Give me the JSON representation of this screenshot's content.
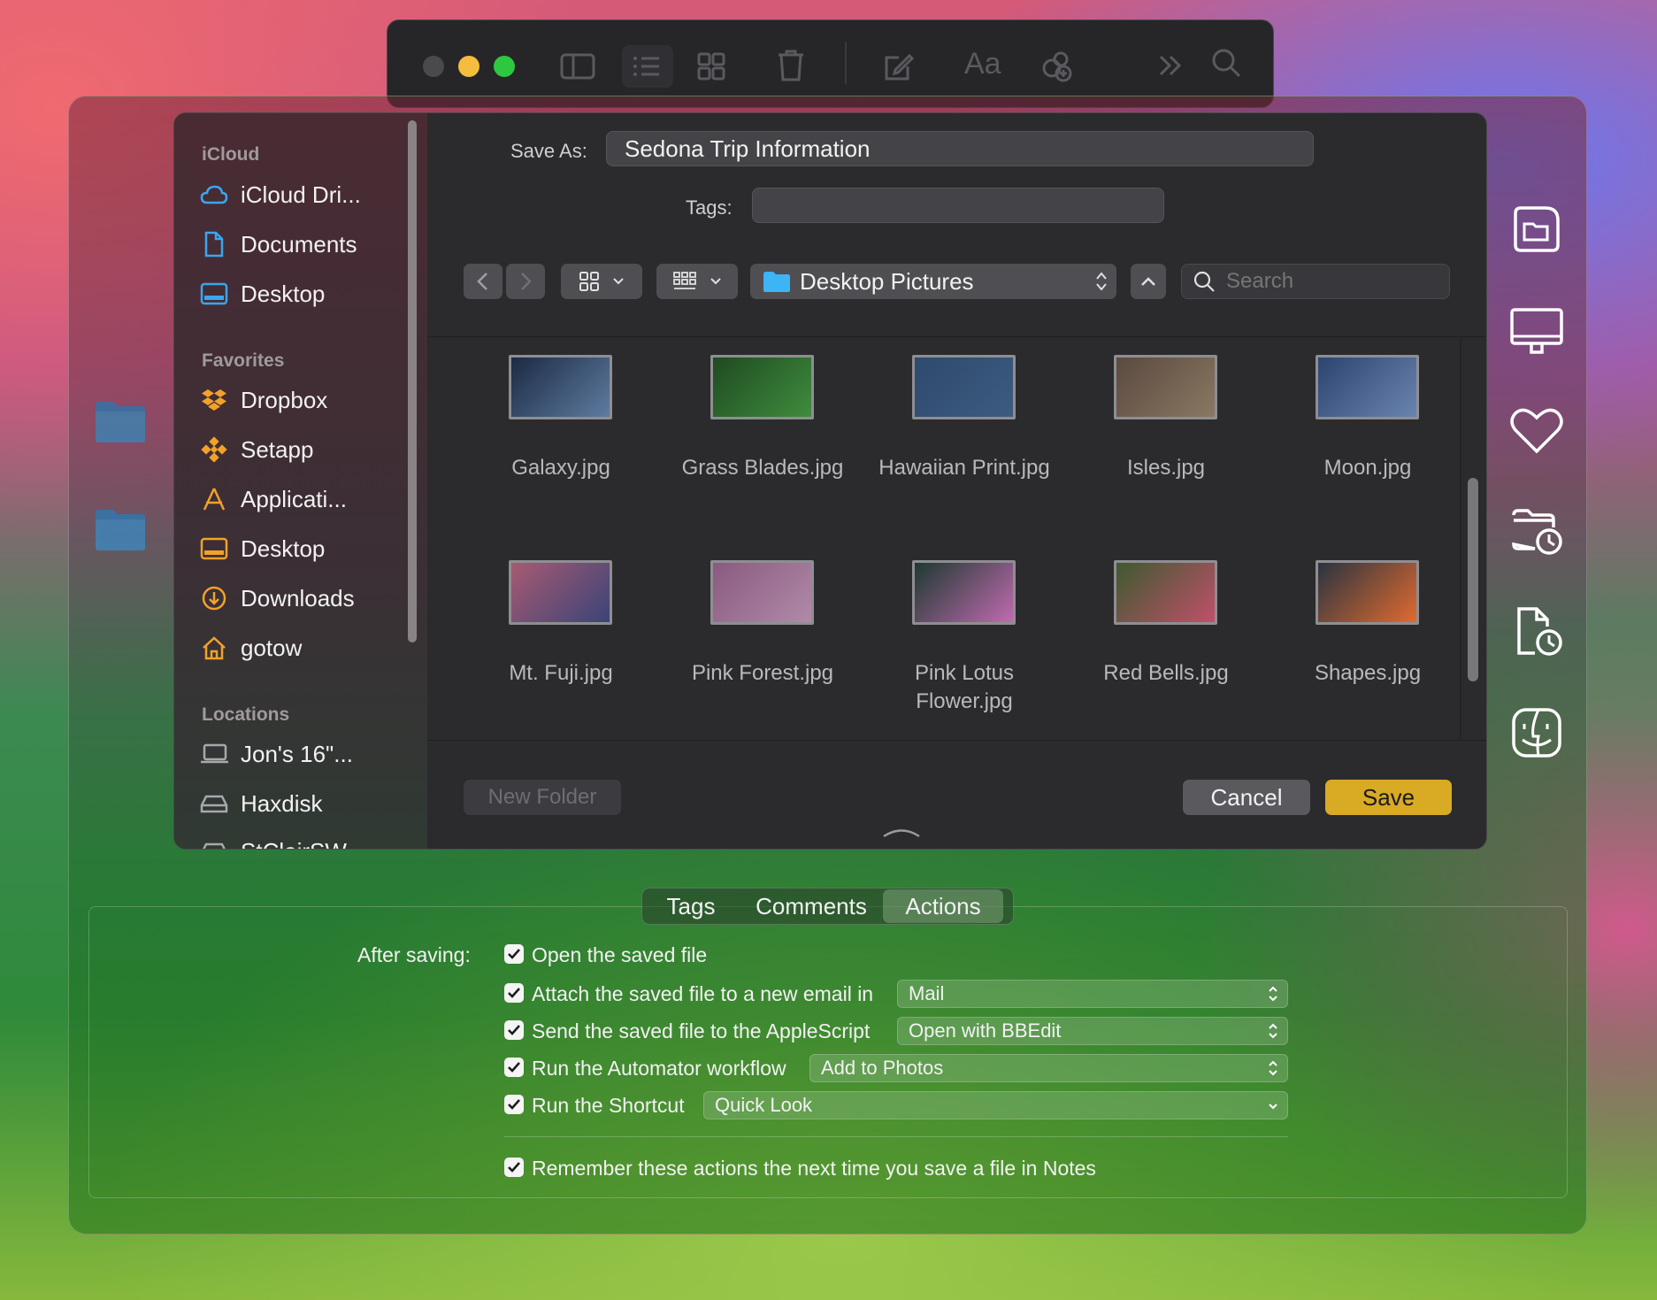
{
  "notes_toolbar": {
    "buttons": [
      "sidebar-icon",
      "list-icon",
      "gallery-icon",
      "trash-icon",
      "compose-icon",
      "format-icon",
      "collaborate-icon",
      "more-icon",
      "search-icon"
    ],
    "format_label": "Aa"
  },
  "dialog": {
    "save_as_label": "Save As:",
    "save_as_value": "Sedona Trip Information",
    "tags_label": "Tags:",
    "tags_value": "",
    "location": "Desktop Pictures",
    "search_placeholder": "Search",
    "new_folder": "New Folder",
    "cancel": "Cancel",
    "save": "Save",
    "accent_color": "#e0b02a"
  },
  "sidebar": {
    "sections": [
      {
        "title": "iCloud",
        "items": [
          {
            "label": "iCloud Dri...",
            "icon": "cloud-icon"
          },
          {
            "label": "Documents",
            "icon": "document-icon"
          },
          {
            "label": "Desktop",
            "icon": "desktop-icon"
          }
        ]
      },
      {
        "title": "Favorites",
        "items": [
          {
            "label": "Dropbox",
            "icon": "dropbox-icon"
          },
          {
            "label": "Setapp",
            "icon": "setapp-icon"
          },
          {
            "label": "Applicati...",
            "icon": "applications-icon"
          },
          {
            "label": "Desktop",
            "icon": "desktop-icon"
          },
          {
            "label": "Downloads",
            "icon": "downloads-icon"
          },
          {
            "label": "gotow",
            "icon": "home-icon"
          }
        ]
      },
      {
        "title": "Locations",
        "items": [
          {
            "label": "Jon's 16\"...",
            "icon": "laptop-icon"
          },
          {
            "label": "Haxdisk",
            "icon": "disk-icon"
          },
          {
            "label": "StClairSW...",
            "icon": "disk-icon"
          }
        ]
      }
    ]
  },
  "files": [
    {
      "name": "Galaxy.jpg",
      "colors": [
        "#1c2a44",
        "#5e7ca0"
      ]
    },
    {
      "name": "Grass Blades.jpg",
      "colors": [
        "#1f4a22",
        "#3f8c3c"
      ]
    },
    {
      "name": "Hawaiian Print.jpg",
      "colors": [
        "#2e4a6e",
        "#3d5a80"
      ]
    },
    {
      "name": "Isles.jpg",
      "colors": [
        "#5a4a40",
        "#8a7862"
      ]
    },
    {
      "name": "Moon.jpg",
      "colors": [
        "#2c4470",
        "#6a84b0"
      ]
    },
    {
      "name": "Mt. Fuji.jpg",
      "colors": [
        "#a85a72",
        "#3a4478"
      ]
    },
    {
      "name": "Pink Forest.jpg",
      "colors": [
        "#8a5a80",
        "#b08aa8"
      ]
    },
    {
      "name": "Pink Lotus Flower.jpg",
      "colors": [
        "#1e3a30",
        "#c06ab0"
      ]
    },
    {
      "name": "Red Bells.jpg",
      "colors": [
        "#3e5a30",
        "#c0506a"
      ]
    },
    {
      "name": "Shapes.jpg",
      "colors": [
        "#2a3440",
        "#e06a30"
      ]
    }
  ],
  "tabs": {
    "items": [
      "Tags",
      "Comments",
      "Actions"
    ],
    "selected": "Actions"
  },
  "actions": {
    "after_saving_label": "After saving:",
    "rows": [
      {
        "label": "Open the saved file",
        "checked": true,
        "popup": ""
      },
      {
        "label": "Attach the saved file to a new email in",
        "checked": true,
        "popup": "Mail"
      },
      {
        "label": "Send the saved file to the AppleScript",
        "checked": true,
        "popup": "Open with BBEdit"
      },
      {
        "label": "Run the Automator workflow",
        "checked": true,
        "popup": "Add to Photos"
      },
      {
        "label": "Run the Shortcut",
        "checked": true,
        "popup": "Quick Look"
      }
    ],
    "remember": {
      "label": "Remember these actions the next time you save a file in Notes",
      "checked": true
    }
  },
  "right_icons": [
    "folder-icon",
    "display-icon",
    "heart-icon",
    "recent-folder-icon",
    "recent-document-icon",
    "finder-icon"
  ]
}
